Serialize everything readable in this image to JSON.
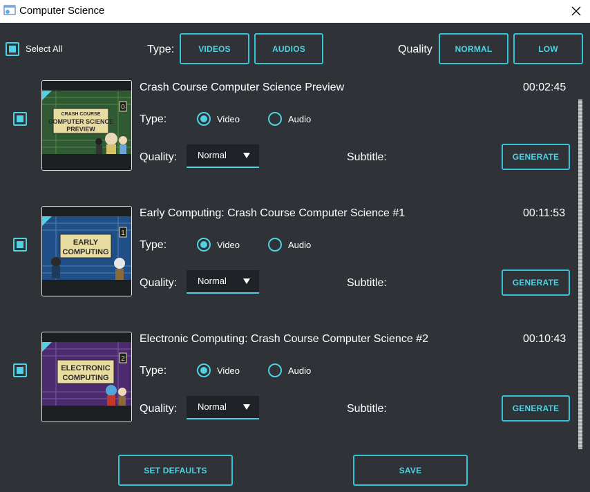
{
  "window": {
    "title": "Computer Science",
    "icon": "app-icon",
    "close_icon": "close-icon"
  },
  "toolbar": {
    "select_all_label": "Select All",
    "type_label": "Type:",
    "videos_button": "VIDEOS",
    "audios_button": "AUDIOS",
    "quality_label": "Quality",
    "normal_button": "NORMAL",
    "low_button": "LOW"
  },
  "items": [
    {
      "title": "Crash Course Computer Science Preview",
      "duration": "00:02:45",
      "type_label": "Type:",
      "video_label": "Video",
      "audio_label": "Audio",
      "selected_type": "Video",
      "quality_label": "Quality:",
      "quality_value": "Normal",
      "subtitle_label": "Subtitle:",
      "generate_button": "GENERATE",
      "checked": true,
      "thumb": {
        "badge": "0",
        "top_text": "CRASH COURSE",
        "line1": "COMPUTER SCIENCE",
        "line2": "PREVIEW",
        "bg": "#2f5a33",
        "accent": "#4fd2e3"
      }
    },
    {
      "title": "Early Computing: Crash Course Computer Science #1",
      "duration": "00:11:53",
      "type_label": "Type:",
      "video_label": "Video",
      "audio_label": "Audio",
      "selected_type": "Video",
      "quality_label": "Quality:",
      "quality_value": "Normal",
      "subtitle_label": "Subtitle:",
      "generate_button": "GENERATE",
      "checked": true,
      "thumb": {
        "badge": "1",
        "top_text": "",
        "line1": "EARLY",
        "line2": "COMPUTING",
        "bg": "#1f4f86",
        "accent": "#4fd2e3"
      }
    },
    {
      "title": "Electronic Computing: Crash Course Computer Science #2",
      "duration": "00:10:43",
      "type_label": "Type:",
      "video_label": "Video",
      "audio_label": "Audio",
      "selected_type": "Video",
      "quality_label": "Quality:",
      "quality_value": "Normal",
      "subtitle_label": "Subtitle:",
      "generate_button": "GENERATE",
      "checked": true,
      "thumb": {
        "badge": "2",
        "top_text": "",
        "line1": "ELECTRONIC",
        "line2": "COMPUTING",
        "bg": "#4c2a6e",
        "accent": "#4fd2e3"
      }
    }
  ],
  "footer": {
    "set_defaults_button": "SET DEFAULTS",
    "save_button": "SAVE"
  },
  "colors": {
    "background": "#2f3237",
    "accent": "#4fd2e3",
    "dropdown_bg": "#1f2226",
    "titlebar": "#ffffff"
  }
}
